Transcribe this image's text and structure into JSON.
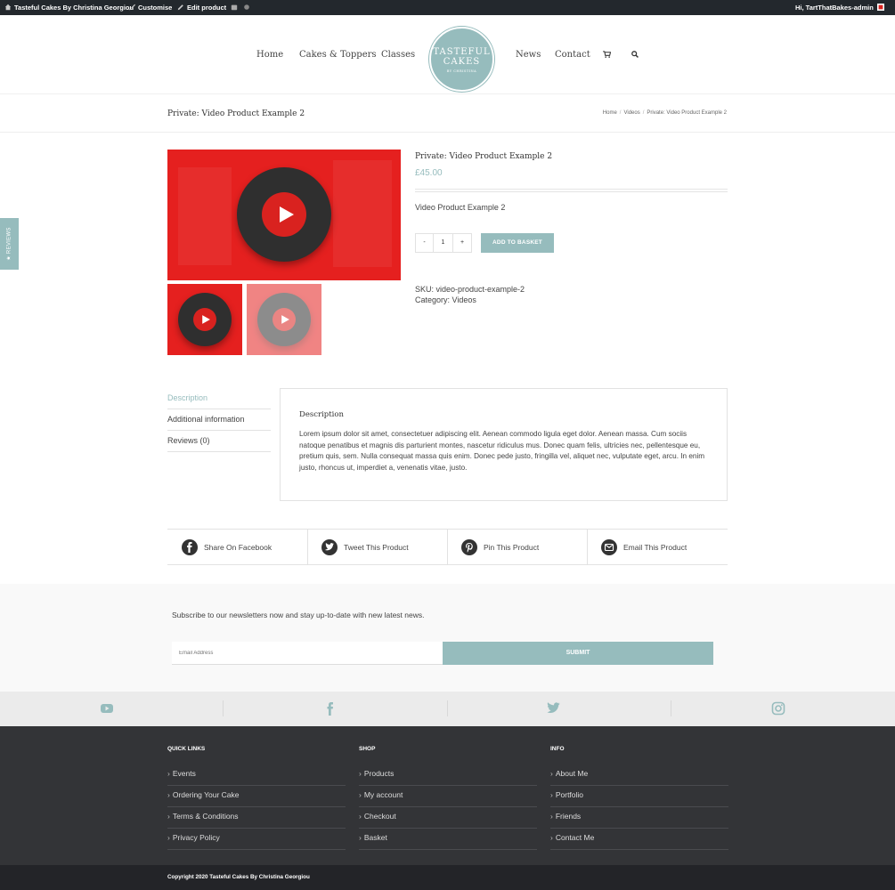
{
  "admin_bar": {
    "site_name": "Tasteful Cakes By Christina Georgiou",
    "customise": "Customise",
    "edit_product": "Edit product",
    "greeting": "Hi, TartThatBakes-admin"
  },
  "nav": {
    "home": "Home",
    "cakes": "Cakes & Toppers",
    "classes": "Classes",
    "news": "News",
    "contact": "Contact"
  },
  "logo": {
    "line1": "TASTEFUL",
    "line2": "CAKES",
    "line3": "BY CHRISTINA"
  },
  "title_bar": {
    "title": "Private: Video Product Example 2",
    "breadcrumb": [
      "Home",
      "Videos",
      "Private: Video Product Example 2"
    ]
  },
  "product": {
    "name": "Private: Video Product Example 2",
    "price": "£45.00",
    "short_description": "Video Product Example 2",
    "qty_minus": "-",
    "qty_value": "1",
    "qty_plus": "+",
    "add_to_basket": "ADD TO BASKET",
    "sku": "SKU: video-product-example-2",
    "category": "Category: Videos"
  },
  "tabs": {
    "items": [
      "Description",
      "Additional information",
      "Reviews (0)"
    ],
    "panel_title": "Description",
    "panel_text": "Lorem ipsum dolor sit amet, consectetuer adipiscing elit. Aenean commodo ligula eget dolor. Aenean massa. Cum sociis natoque penatibus et magnis dis parturient montes, nascetur ridiculus mus. Donec quam felis, ultricies nec, pellentesque eu, pretium quis, sem. Nulla consequat massa quis enim. Donec pede justo, fringilla vel, aliquet nec, vulputate eget, arcu. In enim justo, rhoncus ut, imperdiet a, venenatis vitae, justo."
  },
  "share": {
    "facebook": "Share On Facebook",
    "twitter": "Tweet This Product",
    "pinterest": "Pin This Product",
    "email": "Email This Product"
  },
  "newsletter": {
    "text": "Subscribe to our newsletters now and stay up-to-date with new latest news.",
    "placeholder": "Email Address",
    "submit": "SUBMIT"
  },
  "footer": {
    "quick_links_title": "QUICK LINKS",
    "quick_links": [
      "Events",
      "Ordering Your Cake",
      "Terms & Conditions",
      "Privacy Policy"
    ],
    "shop_title": "SHOP",
    "shop": [
      "Products",
      "My account",
      "Checkout",
      "Basket"
    ],
    "info_title": "INFO",
    "info": [
      "About Me",
      "Portfolio",
      "Friends",
      "Contact Me"
    ],
    "copyright": "Copyright 2020 Tasteful Cakes By Christina Georgiou"
  },
  "reviews_tab": "★ REVIEWS",
  "colors": {
    "accent": "#96bcbd",
    "footer": "#333437",
    "video_red": "#e5201f"
  }
}
